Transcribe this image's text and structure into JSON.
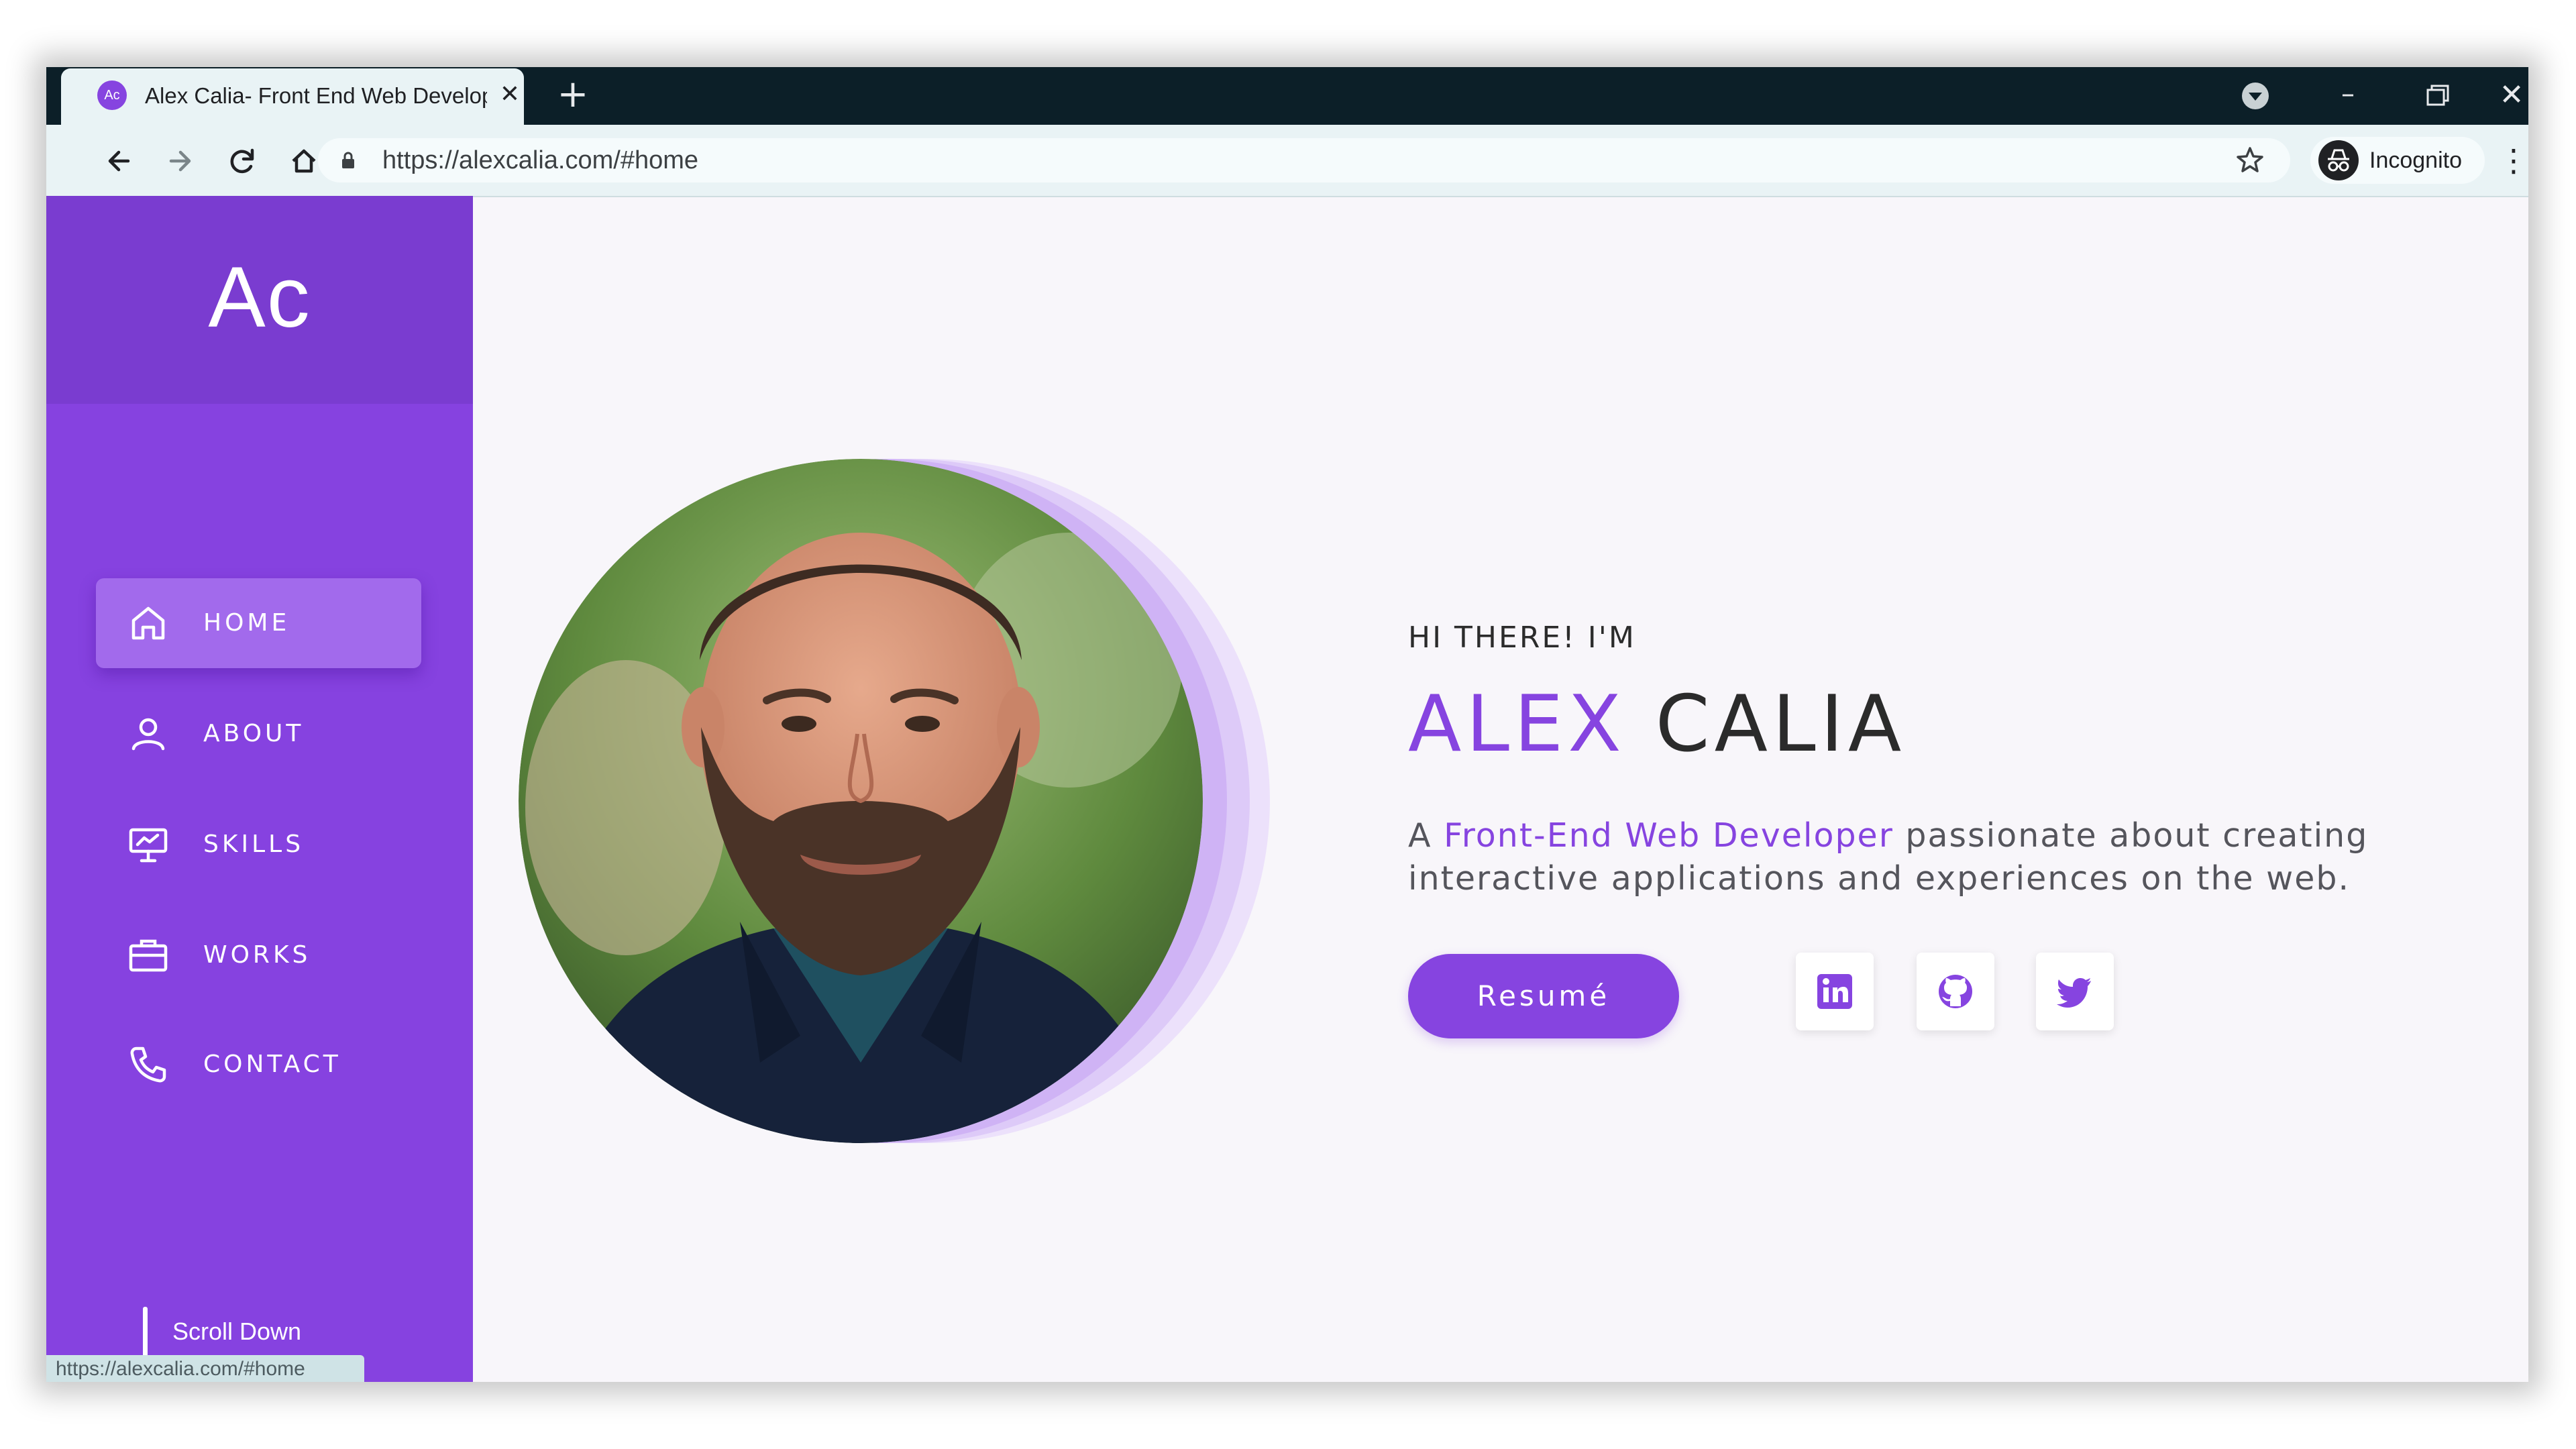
{
  "browser": {
    "tab_title": "Alex Calia- Front End Web Developer",
    "tab_favicon_text": "Ac",
    "tab_close": "✕",
    "new_tab": "+",
    "url": "https://alexcalia.com/#home",
    "profile_label": "Incognito",
    "minimize": "–",
    "close": "✕",
    "menu": "⋮",
    "status_url": "https://alexcalia.com/#home"
  },
  "sidebar": {
    "logo": "Ac",
    "items": [
      {
        "label": "HOME",
        "icon": "home-icon",
        "active": true
      },
      {
        "label": "ABOUT",
        "icon": "user-icon",
        "active": false
      },
      {
        "label": "SKILLS",
        "icon": "presentation-icon",
        "active": false
      },
      {
        "label": "WORKS",
        "icon": "briefcase-icon",
        "active": false
      },
      {
        "label": "CONTACT",
        "icon": "phone-icon",
        "active": false
      }
    ],
    "scroll_label": "Scroll Down"
  },
  "hero": {
    "greeting": "HI THERE! I'M",
    "first_name": "ALEX",
    "last_name": "CALIA",
    "desc_prefix": "A ",
    "desc_accent": "Front-End Web Developer",
    "desc_rest": " passionate about creating interactive applications and experiences on the web.",
    "resume_label": "Resumé",
    "social": [
      "linkedin-icon",
      "github-icon",
      "twitter-icon"
    ]
  },
  "colors": {
    "brand": "#8644e0",
    "sidebar": "#8642e0",
    "active_item": "#a26aec",
    "page_bg": "#f8f6fa",
    "chrome_dark": "#0c1f28",
    "chrome_light": "#e9f3f5"
  }
}
